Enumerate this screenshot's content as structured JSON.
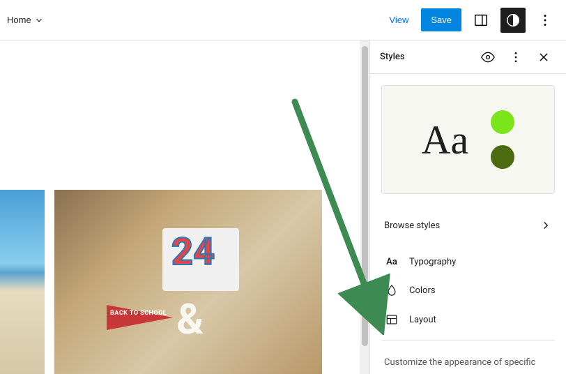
{
  "topbar": {
    "document_label": "Home",
    "view_label": "View",
    "save_label": "Save"
  },
  "sidebar": {
    "title": "Styles",
    "preview": {
      "sample_text": "Aa",
      "accent1": "#7ae619",
      "accent2": "#4a6b0f"
    },
    "browse_label": "Browse styles",
    "sections": [
      {
        "icon": "Aa",
        "label": "Typography"
      },
      {
        "icon": "drop",
        "label": "Colors"
      },
      {
        "icon": "layout",
        "label": "Layout"
      }
    ],
    "customize_text": "Customize the appearance of specific"
  },
  "canvas": {
    "image2_number": "24",
    "image2_pennant": "BACK TO SCHOOL"
  }
}
